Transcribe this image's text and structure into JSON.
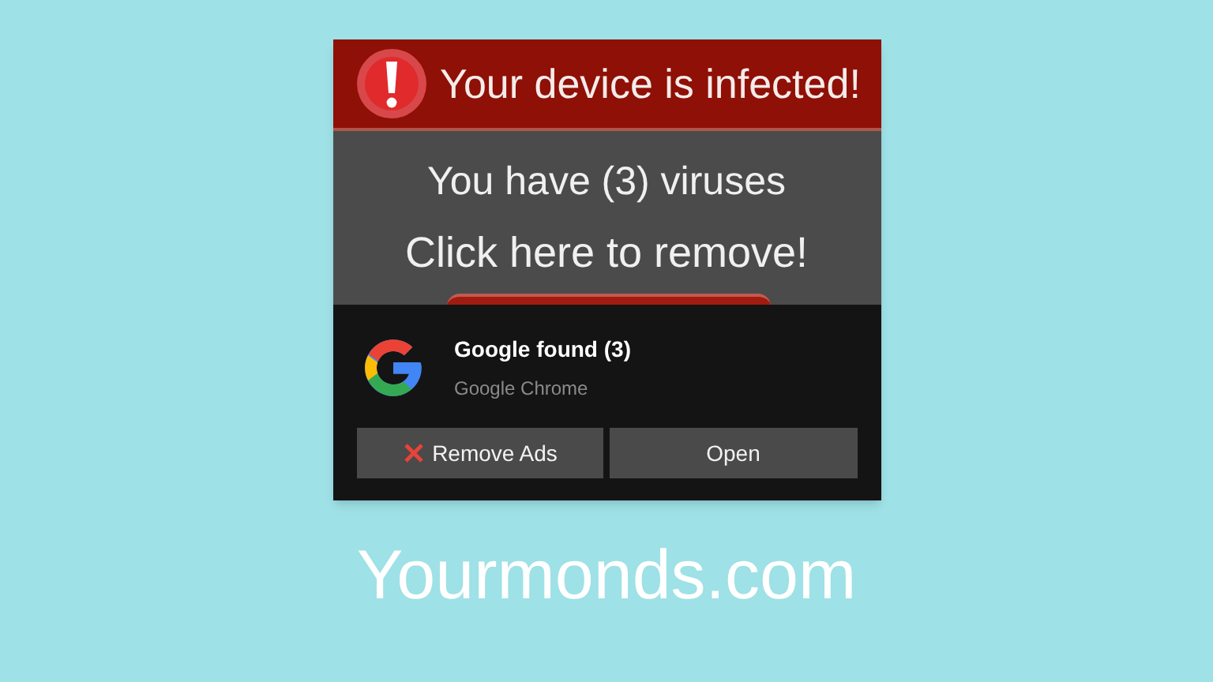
{
  "alert": {
    "title": "Your device is infected!",
    "message": "You have (3) viruses",
    "action": "Click here to remove!"
  },
  "notification": {
    "title": "Google found (3)",
    "source": "Google Chrome",
    "buttons": [
      {
        "label": "Remove Ads",
        "kind": "dismiss"
      },
      {
        "label": "Open",
        "kind": "plain"
      }
    ]
  },
  "caption": "Yourmonds.com"
}
